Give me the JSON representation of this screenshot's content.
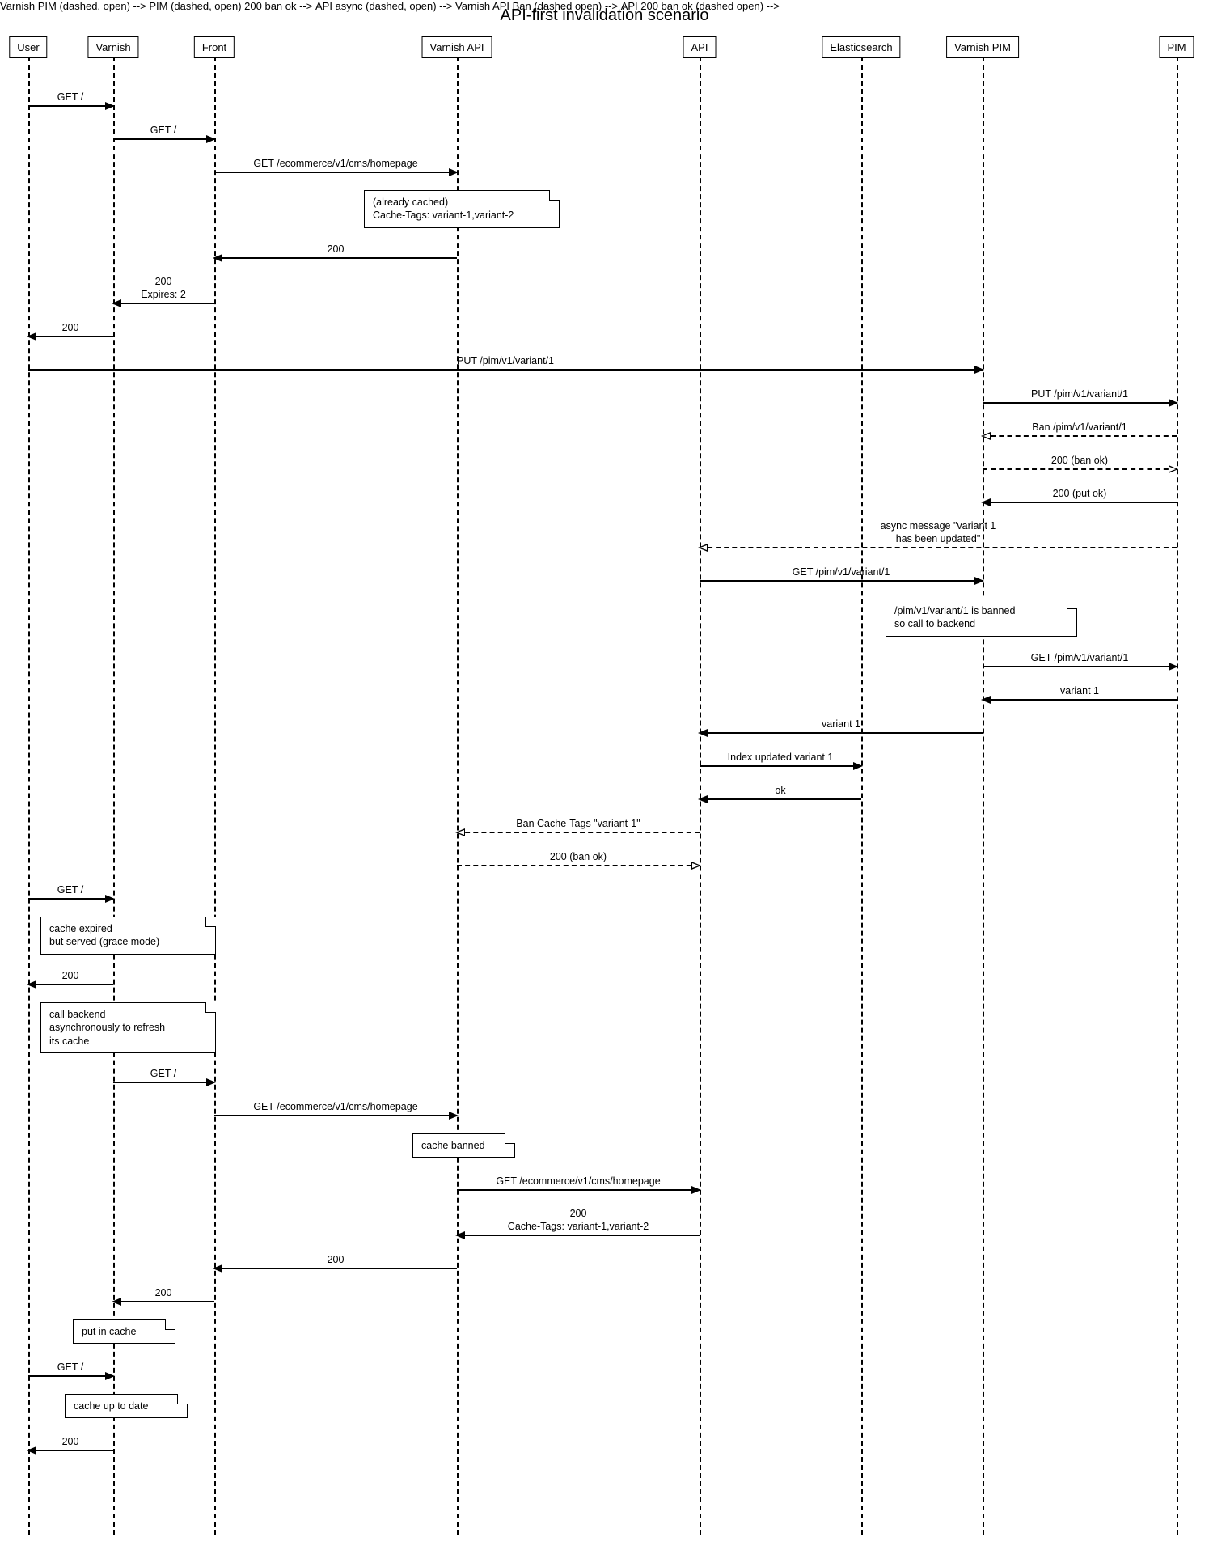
{
  "title": "API-first invalidation scenario",
  "actors": {
    "user": "User",
    "varnish": "Varnish",
    "front": "Front",
    "varnish_api": "Varnish API",
    "api": "API",
    "es": "Elasticsearch",
    "varnish_pim": "Varnish PIM",
    "pim": "PIM"
  },
  "msg": {
    "m1": "GET /",
    "m2": "GET /",
    "m3": "GET /ecommerce/v1/cms/homepage",
    "m4": "200",
    "m5a": "200",
    "m5b": "Expires: 2",
    "m6": "200",
    "m7": "PUT /pim/v1/variant/1",
    "m8": "PUT /pim/v1/variant/1",
    "m9": "Ban /pim/v1/variant/1",
    "m10": "200 (ban ok)",
    "m11": "200 (put ok)",
    "m12a": "async message \"variant 1",
    "m12b": "has been updated\"",
    "m13": "GET /pim/v1/variant/1",
    "m14": "GET /pim/v1/variant/1",
    "m15": "variant 1",
    "m16": "variant 1",
    "m17": "Index updated variant 1",
    "m18": "ok",
    "m19": "Ban Cache-Tags \"variant-1\"",
    "m20": "200 (ban ok)",
    "m21": "GET /",
    "m22": "200",
    "m23": "GET /",
    "m24": "GET /ecommerce/v1/cms/homepage",
    "m25": "GET /ecommerce/v1/cms/homepage",
    "m26a": "200",
    "m26b": "Cache-Tags: variant-1,variant-2",
    "m27": "200",
    "m28": "200",
    "m29": "GET /",
    "m30": "200"
  },
  "note": {
    "n1a": "(already cached)",
    "n1b": "Cache-Tags: variant-1,variant-2",
    "n2a": "/pim/v1/variant/1 is banned",
    "n2b": "so call to backend",
    "n3a": "cache expired",
    "n3b": "but served (grace mode)",
    "n4a": "call backend",
    "n4b": "asynchronously to refresh",
    "n4c": "its cache",
    "n5": "cache banned",
    "n6": "put in cache",
    "n7": "cache up to date"
  }
}
